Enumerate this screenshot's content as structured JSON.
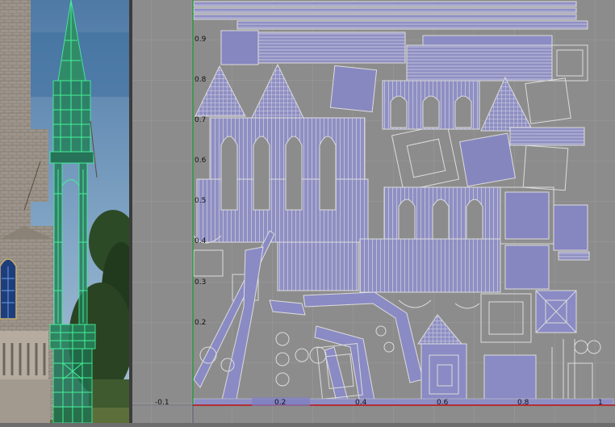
{
  "uv_editor": {
    "v_axis_labels": [
      "0.9",
      "0.8",
      "0.7",
      "0.6",
      "0.5",
      "0.4",
      "0.3",
      "0.2"
    ],
    "u_axis_labels": [
      "-0.1",
      "0.2",
      "0.4",
      "0.6",
      "0.8",
      "1"
    ],
    "u_axis_highlight": "0.2",
    "grid_color": "#9a9a9a",
    "background_color": "#8c8c8c",
    "uv_shell_fill": "#8c8cc2",
    "uv_edge_color": "#dcdcdc",
    "u_axis_color": "#c03030",
    "v_axis_color": "#2fd12f"
  },
  "viewport": {
    "selection_color": "#46f29a",
    "sky_color": "#5f88b0",
    "foliage_color": "#233a1f"
  }
}
